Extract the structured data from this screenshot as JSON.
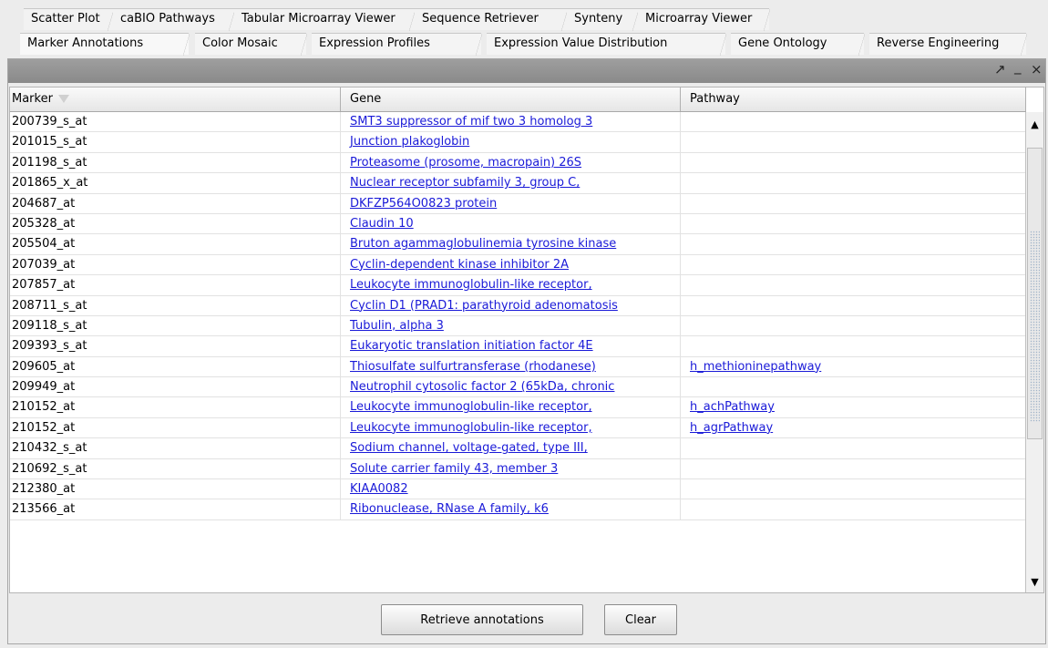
{
  "tabs": {
    "row1": [
      "Scatter Plot",
      "caBIO Pathways",
      "Tabular Microarray Viewer",
      "Sequence Retriever",
      "Synteny",
      "Microarray Viewer"
    ],
    "row2": [
      "Marker Annotations",
      "Color Mosaic",
      "Expression Profiles",
      "Expression Value Distribution",
      "Gene Ontology",
      "Reverse Engineering"
    ],
    "active": "Marker Annotations"
  },
  "panel": {
    "controls": {
      "undock": "↗",
      "minimize": "_",
      "close": "×"
    }
  },
  "table": {
    "columns": [
      "Marker",
      "Gene",
      "Pathway"
    ],
    "sorted_column_icon": "sort-down-icon",
    "rows": [
      {
        "marker": "200739_s_at",
        "gene": "SMT3 suppressor of mif two 3 homolog 3 ",
        "pathway": ""
      },
      {
        "marker": "201015_s_at",
        "gene": "Junction plakoglobin",
        "pathway": ""
      },
      {
        "marker": "201198_s_at",
        "gene": "Proteasome (prosome, macropain) 26S ",
        "pathway": ""
      },
      {
        "marker": "201865_x_at",
        "gene": "Nuclear receptor subfamily 3, group C, ",
        "pathway": ""
      },
      {
        "marker": "204687_at",
        "gene": "DKFZP564O0823 protein",
        "pathway": ""
      },
      {
        "marker": "205328_at",
        "gene": "Claudin 10",
        "pathway": ""
      },
      {
        "marker": "205504_at",
        "gene": "Bruton agammaglobulinemia tyrosine kinase",
        "pathway": ""
      },
      {
        "marker": "207039_at",
        "gene": "Cyclin-dependent kinase inhibitor 2A ",
        "pathway": ""
      },
      {
        "marker": "207857_at",
        "gene": "Leukocyte immunoglobulin-like receptor, ",
        "pathway": ""
      },
      {
        "marker": "208711_s_at",
        "gene": "Cyclin D1 (PRAD1: parathyroid adenomatosis ",
        "pathway": ""
      },
      {
        "marker": "209118_s_at",
        "gene": "Tubulin, alpha 3",
        "pathway": ""
      },
      {
        "marker": "209393_s_at",
        "gene": "Eukaryotic translation initiation factor 4E ",
        "pathway": ""
      },
      {
        "marker": "209605_at",
        "gene": "Thiosulfate sulfurtransferase (rhodanese)",
        "pathway": "h_methioninepathway"
      },
      {
        "marker": "209949_at",
        "gene": "Neutrophil cytosolic factor 2 (65kDa, chronic ",
        "pathway": ""
      },
      {
        "marker": "210152_at",
        "gene": "Leukocyte immunoglobulin-like receptor, ",
        "pathway": "h_achPathway"
      },
      {
        "marker": "210152_at",
        "gene": "Leukocyte immunoglobulin-like receptor, ",
        "pathway": "h_agrPathway"
      },
      {
        "marker": "210432_s_at",
        "gene": "Sodium channel, voltage-gated, type III, ",
        "pathway": ""
      },
      {
        "marker": "210692_s_at",
        "gene": "Solute carrier family 43, member 3",
        "pathway": ""
      },
      {
        "marker": "212380_at",
        "gene": "KIAA0082",
        "pathway": ""
      },
      {
        "marker": "213566_at",
        "gene": "Ribonuclease, RNase A family, k6",
        "pathway": ""
      }
    ]
  },
  "scrollbar": {
    "up_icon": "▲",
    "down_icon": "▼"
  },
  "buttons": {
    "retrieve_label": "Retrieve annotations",
    "clear_label": "Clear"
  },
  "colors": {
    "link": "#1a1ad8",
    "titlebar": "#949494",
    "background": "#ececec"
  }
}
